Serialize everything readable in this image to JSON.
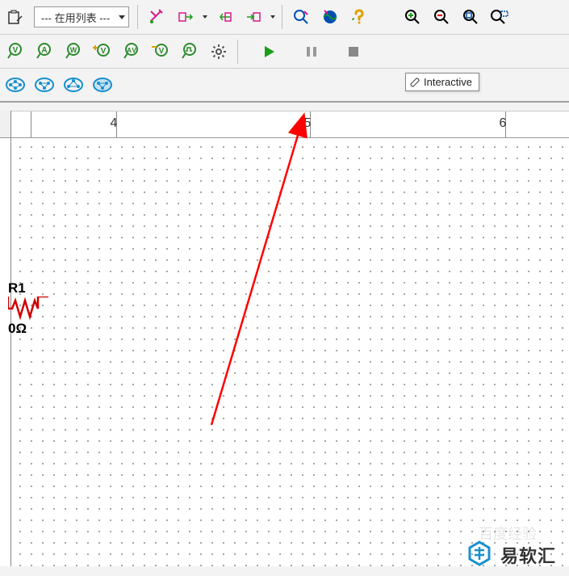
{
  "toolbar": {
    "dropdown_label": "--- 在用列表 ---",
    "icons_row1": [
      "paste-icon",
      "dropdown-icon",
      "highlight-icon",
      "arrow-out-icon",
      "arrow-dd1",
      "arrow-back-icon",
      "arrow-fwd-icon",
      "arrow-dd2",
      "zoom-area-icon",
      "web-icon",
      "help-icon",
      "zoom-in-icon",
      "zoom-out-icon",
      "zoom-fit-icon",
      "zoom-select-icon"
    ],
    "icons_row2": [
      "probe-v-icon",
      "probe-a-icon",
      "probe-w-icon",
      "probe-add-icon",
      "probe-av-icon",
      "probe-neg-icon",
      "probe-pulse-icon",
      "gear-icon"
    ],
    "icons_row3": [
      "net-1-icon",
      "net-2-icon",
      "net-3-icon",
      "net-4-icon"
    ]
  },
  "simulation": {
    "play_label": "Run",
    "pause_label": "Pause",
    "stop_label": "Stop",
    "tooltip": "Interactive"
  },
  "ruler": {
    "ticks": [
      {
        "pos": 24,
        "label": ""
      },
      {
        "pos": 130,
        "label": "4"
      },
      {
        "pos": 370,
        "label": "5"
      },
      {
        "pos": 612,
        "label": "6"
      }
    ]
  },
  "component": {
    "reference": "R1",
    "value": "0Ω"
  },
  "watermark": {
    "text": "易软汇",
    "faint": "百度经验"
  },
  "colors": {
    "probe_green": "#2d8a2d",
    "play_green": "#1a9e1a",
    "accent_blue": "#1890d0",
    "magenta": "#d81b8c",
    "orange": "#e67e22",
    "arrow_red": "#ff0000"
  }
}
